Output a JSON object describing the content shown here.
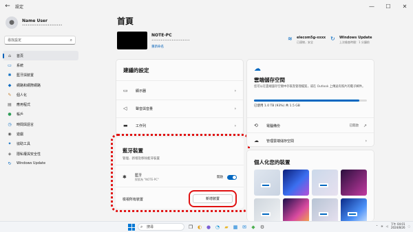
{
  "window": {
    "title": "設定",
    "back": "←",
    "min": "—",
    "max": "☐",
    "close": "✕"
  },
  "user": {
    "name": "Name User",
    "email": "••••••••••••••••••••••"
  },
  "search": {
    "placeholder": "尋找設定"
  },
  "nav": [
    {
      "label": "首頁",
      "icon": "home-icon",
      "glyph": "⌂",
      "color": "#444",
      "active": true
    },
    {
      "label": "系統",
      "icon": "system-icon",
      "glyph": "▭",
      "color": "#0067c0",
      "active": false
    },
    {
      "label": "藍牙與裝置",
      "icon": "bluetooth-devices-icon",
      "glyph": "✱",
      "color": "#0067c0",
      "active": false
    },
    {
      "label": "網路和網際網路",
      "icon": "network-icon",
      "glyph": "◆",
      "color": "#0067c0",
      "active": false
    },
    {
      "label": "個人化",
      "icon": "personalization-icon",
      "glyph": "✎",
      "color": "#c57b25",
      "active": false
    },
    {
      "label": "應用程式",
      "icon": "apps-icon",
      "glyph": "▤",
      "color": "#555",
      "active": false
    },
    {
      "label": "帳戶",
      "icon": "accounts-icon",
      "glyph": "●",
      "color": "#2e9d57",
      "active": false
    },
    {
      "label": "時間與語言",
      "icon": "time-language-icon",
      "glyph": "◷",
      "color": "#0067c0",
      "active": false
    },
    {
      "label": "遊戲",
      "icon": "gaming-icon",
      "glyph": "◉",
      "color": "#555",
      "active": false
    },
    {
      "label": "協助工具",
      "icon": "accessibility-icon",
      "glyph": "✦",
      "color": "#0067c0",
      "active": false
    },
    {
      "label": "隱私權與安全性",
      "icon": "privacy-icon",
      "glyph": "◈",
      "color": "#666",
      "active": false
    },
    {
      "label": "Windows Update",
      "icon": "windows-update-icon",
      "glyph": "↻",
      "color": "#0067c0",
      "active": false
    }
  ],
  "home": {
    "title": "首頁",
    "pc_name": "NOTE-PC",
    "pc_model": "•••••••••••••••••••••",
    "rename": "重新命名",
    "wifi": {
      "title": "elecom5g-xxxx",
      "sub": "已連線，安全"
    },
    "update": {
      "title": "Windows Update",
      "sub": "上次檢查時間：1 分鐘前"
    }
  },
  "recommended": {
    "title": "建議的設定",
    "rows": [
      {
        "label": "顯示器",
        "icon": "display-icon",
        "glyph": "▭"
      },
      {
        "label": "聲音與音量",
        "icon": "sound-icon",
        "glyph": "◁"
      },
      {
        "label": "工作列",
        "icon": "taskbar-icon",
        "glyph": "▬"
      }
    ]
  },
  "bluetooth": {
    "title": "藍牙裝置",
    "subtitle": "管理、新增及移除藍牙裝置",
    "bt_label": "藍牙",
    "bt_sub": "探索為 \"NOTE-PC\"",
    "bt_state": "開啟",
    "pair_label": "檢視所有裝置",
    "add_button": "新增裝置"
  },
  "cloud": {
    "title": "雲端儲存空間",
    "desc": "您可以在雲端儲存空間中存取及管理檔案，或在 Outlook 上傳送有照片的電子郵件。",
    "usage": "已使用 1.0 TB (93%) 共 1.5 GB",
    "usage_fraction": 0.93,
    "rows": [
      {
        "label": "電腦備份",
        "status": "已開啟",
        "icon": "backup-icon",
        "glyph": "⟲"
      },
      {
        "label": "管理雲端儲存空間",
        "status": "",
        "icon": "cloud-manage-icon",
        "glyph": "☁"
      }
    ]
  },
  "personalize": {
    "title": "個人化您的裝置",
    "thumbs": [
      {
        "bg": "linear-gradient(135deg,#dfe6ef,#c9d3e1)",
        "mini": true
      },
      {
        "bg": "linear-gradient(135deg,#0b1f7a,#3b6ff0 55%,#b64fd8)",
        "mini": false
      },
      {
        "bg": "linear-gradient(135deg,#cbd9ea,#e7e0ef)",
        "mini": true
      },
      {
        "bg": "linear-gradient(135deg,#2a0f3d,#c23aa0)",
        "mini": false
      },
      {
        "bg": "linear-gradient(135deg,#cfd6dd,#f1f3f5)",
        "mini": true
      },
      {
        "bg": "linear-gradient(135deg,#1b0f4a,#d94aa0 60%,#f6b040)",
        "mini": false
      },
      {
        "bg": "linear-gradient(135deg,#b7c4d4,#e9e2f1)",
        "mini": true
      },
      {
        "bg": "linear-gradient(135deg,#0a2a88,#4a8ff6 60%,#d2e6ff)",
        "mini": true
      }
    ]
  },
  "taskbar": {
    "search": "搜尋",
    "time": "下午 04:01",
    "date": "2024/8/26",
    "icons": [
      {
        "name": "task-view-icon",
        "glyph": "❐",
        "color": "#333"
      },
      {
        "name": "widgets-icon",
        "glyph": "◐",
        "color": "#e0a020"
      },
      {
        "name": "chat-icon",
        "glyph": "●",
        "color": "#7b5fd6"
      },
      {
        "name": "edge-icon",
        "glyph": "◔",
        "color": "#1f9ad6"
      },
      {
        "name": "explorer-icon",
        "glyph": "▰",
        "color": "#e8b526"
      },
      {
        "name": "store-icon",
        "glyph": "▦",
        "color": "#0a7bd6"
      },
      {
        "name": "mail-icon",
        "glyph": "✉",
        "color": "#0a7bd6"
      },
      {
        "name": "app-icon",
        "glyph": "◆",
        "color": "#4caf50"
      },
      {
        "name": "settings-icon",
        "glyph": "⚙",
        "color": "#555"
      }
    ]
  }
}
